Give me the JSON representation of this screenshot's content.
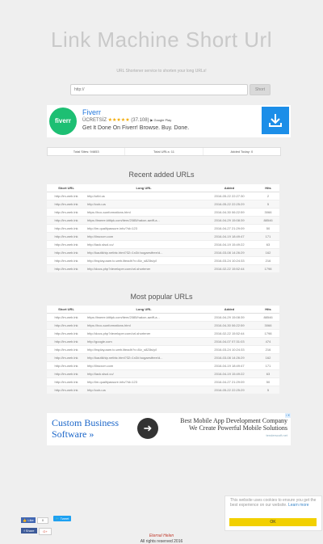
{
  "header": {
    "title": "Link Machine Short Url",
    "subtitle": "URL Shortener service to shorten your long URLs!"
  },
  "search": {
    "placeholder": "http://",
    "button_label": "Short"
  },
  "ad_top": {
    "logo_text": "fiverr",
    "name": "Fiverr",
    "rating_label": "ÜCRETSİZ",
    "stars": "★★★★★",
    "rating_count": "(37.108)",
    "store": "▶ Google Play",
    "tagline": "Get It Done On Fiverr! Browse. Buy. Done."
  },
  "stats": {
    "total_sites": "Total Sites: 94653",
    "total_urls": "Total URLs: 11",
    "added_today": "Added Today: 0"
  },
  "columns": [
    "Short URL",
    "Long URL",
    "Added",
    "Hits"
  ],
  "recent": {
    "title": "Recent added URLs",
    "rows": [
      [
        "http://lm-web.lnk",
        "http://utbl.us",
        "2016-05-22 22:27:30",
        "2"
      ],
      [
        "http://lm-web.lnk",
        "http://cutu.us",
        "2016-05-22 22:25:29",
        "5"
      ],
      [
        "http://lm-web.lnk",
        "https://hoc-sunformations.html",
        "2016-04-30 06:22:59",
        "3066"
      ],
      [
        "http://lm-web.lnk",
        "https://tweee.kittipk.com/item/2085/hakon-awiff-a...",
        "2016-04-29 15:08:39",
        "88546"
      ],
      [
        "http://lm-web.lnk",
        "http://lm.qualityassure.info/?id=123",
        "2016-04-27 21:29:09",
        "50"
      ],
      [
        "http://lm-web.lnk",
        "http://linuxcm.com",
        "2016-04-19 18:49:47",
        "171"
      ],
      [
        "http://lm-web.lnk",
        "http://lack.slsol.co/",
        "2016-04-19 15:49:22",
        "63"
      ],
      [
        "http://lm-web.lnk",
        "http://kautikhip.netbtc.html?32=1n3/r/oogaestfree/d...",
        "2016-03-08 14:26:29",
        "162"
      ],
      [
        "http://lm-web.lnk",
        "http://hsplay.aam.to.web.liteadh?v=8/z_s8Z8s/y/l",
        "2016-03-24 10:24:33",
        "216"
      ],
      [
        "http://lm-web.lnk",
        "http://docs.php?developer.com/url-shortener",
        "2016-02-22 15:52:44",
        "1798"
      ]
    ]
  },
  "popular": {
    "title": "Most popular URLs",
    "rows": [
      [
        "http://lm-web.lnk",
        "https://tweee.kittipk.com/item/2085/hakon-awiff-a...",
        "2016-04-29 15:08:39",
        "88546"
      ],
      [
        "http://lm-web.lnk",
        "https://hoc-sunformations.html",
        "2016-04-30 06:22:59",
        "3066"
      ],
      [
        "http://lm-web.lnk",
        "http://docs.php?developer.com/url-shortener",
        "2016-02-22 15:52:44",
        "1798"
      ],
      [
        "http://lm-web.lnk",
        "http://google.com",
        "2016-04-07 07:31:03",
        "474"
      ],
      [
        "http://lm-web.lnk",
        "http://hsplay.aam.to.web.liteadh?v=8/z_s8Z8s/y/l",
        "2016-03-24 10:24:33",
        "216"
      ],
      [
        "http://lm-web.lnk",
        "http://kautikhip.netbtc.html?32=1n3/r/oogaestfree/d...",
        "2016-03-08 14:26:29",
        "162"
      ],
      [
        "http://lm-web.lnk",
        "http://linuxcm.com",
        "2016-04-19 18:49:47",
        "171"
      ],
      [
        "http://lm-web.lnk",
        "http://lack.slsol.co/",
        "2016-04-19 15:49:22",
        "63"
      ],
      [
        "http://lm-web.lnk",
        "http://lm.qualityassure.info/?id=123",
        "2016-04-27 21:29:09",
        "50"
      ],
      [
        "http://lm-web.lnk",
        "http://cutu.us",
        "2016-05-22 22:25:29",
        "5"
      ]
    ]
  },
  "ad_bottom": {
    "left_text": "Custom Business Software »",
    "arrow": "➜",
    "right_line1": "Best Mobile App Development Company",
    "right_line2": "We Create Powerful Mobile Solutions",
    "url": "tenderscoft.net",
    "badge": "i ✕"
  },
  "cookie": {
    "text": "This website uses cookies to ensure you get the best experience on our website.",
    "link": "Learn more",
    "button": "OK"
  },
  "social": {
    "like": "👍 Like",
    "like_count": "0",
    "tweet": "🐦 Tweet",
    "share": "f Share",
    "gplus": "G+"
  },
  "footer": {
    "signature": "Eternal Helen",
    "copyright": "All rights reserved 2016"
  },
  "colors": {
    "background": "#efefef",
    "fiverr_green": "#1dbf73",
    "download_blue": "#1c8ee8",
    "cookie_yellow": "#f2d000"
  }
}
